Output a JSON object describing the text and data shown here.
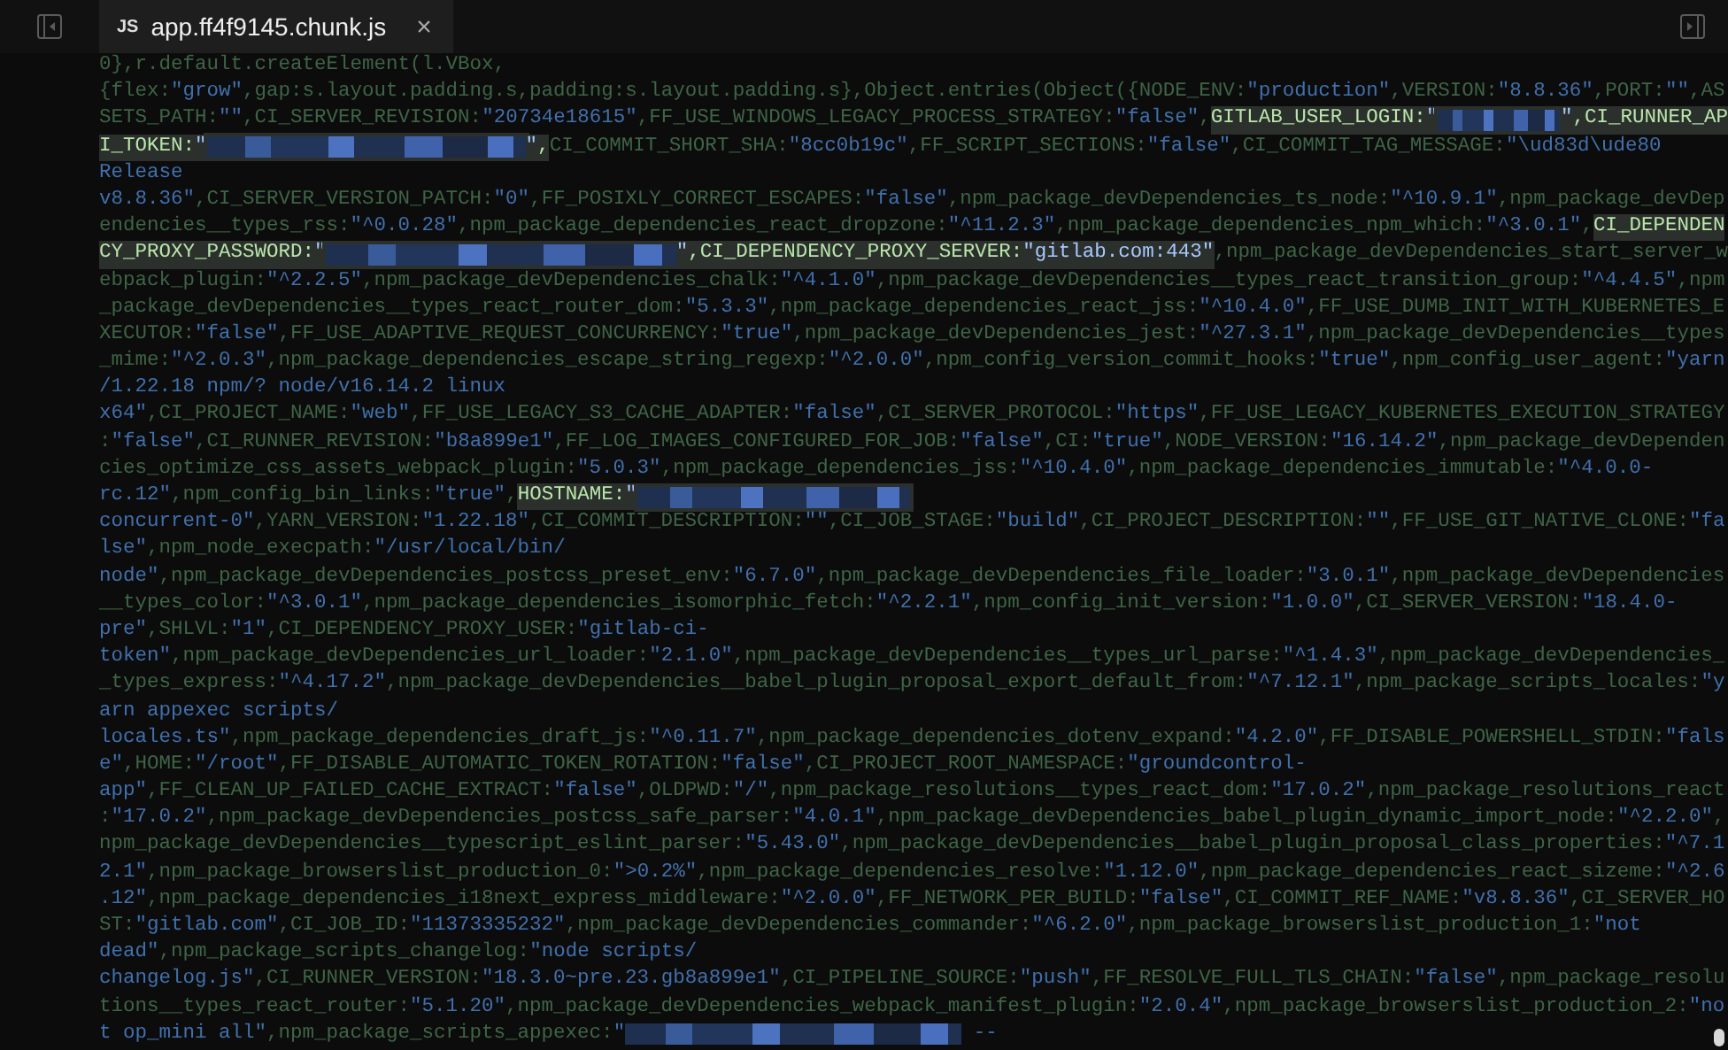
{
  "tab": {
    "badge": "JS",
    "title": "app.ff4f9145.chunk.js",
    "close": "×",
    "selected": true
  },
  "code": [
    [
      {
        "kind": "text",
        "text": "0},r.default.createElement(l.VBox,",
        "highlighted": false
      }
    ],
    [
      {
        "kind": "text",
        "text": "{flex:\"grow\",gap:s.layout.padding.s,padding:s.layout.padding.s},Object.entries(Object({NODE_ENV:\"production\",VERSION:\"8.8.36\",PORT:\"\",AS",
        "highlighted": false
      }
    ],
    [
      {
        "kind": "text",
        "text": "SETS_PATH:\"\",CI_SERVER_REVISION:\"20734e18615\",FF_USE_WINDOWS_LEGACY_PROCESS_STRATEGY:\"false\",",
        "highlighted": false
      },
      {
        "kind": "text",
        "text": "GITLAB_USER_LOGIN:\"",
        "highlighted": true
      },
      {
        "kind": "redacted",
        "highlighted": true
      },
      {
        "kind": "text",
        "text": "\",CI_RUNNER_AP",
        "highlighted": true
      }
    ],
    [
      {
        "kind": "text",
        "text": "I_TOKEN:\"",
        "highlighted": true
      },
      {
        "kind": "redacted",
        "highlighted": true
      },
      {
        "kind": "text",
        "text": "\",",
        "highlighted": true
      },
      {
        "kind": "text",
        "text": "CI_COMMIT_SHORT_SHA:\"8cc0b19c\",FF_SCRIPT_SECTIONS:\"false\",CI_COMMIT_TAG_MESSAGE:\"\\ud83d\\ude80",
        "highlighted": false
      }
    ],
    [
      {
        "kind": "text",
        "text": "Release",
        "highlighted": false
      }
    ],
    [
      {
        "kind": "text",
        "text": "v8.8.36\",CI_SERVER_VERSION_PATCH:\"0\",FF_POSIXLY_CORRECT_ESCAPES:\"false\",npm_package_devDependencies_ts_node:\"^10.9.1\",npm_package_devDep",
        "highlighted": false
      }
    ],
    [
      {
        "kind": "text",
        "text": "endencies__types_rss:\"^0.0.28\",npm_package_dependencies_react_dropzone:\"^11.2.3\",npm_package_dependencies_npm_which:\"^3.0.1\",",
        "highlighted": false
      },
      {
        "kind": "text",
        "text": "CI_DEPENDEN",
        "highlighted": true
      }
    ],
    [
      {
        "kind": "text",
        "text": "CY_PROXY_PASSWORD:\"",
        "highlighted": true
      },
      {
        "kind": "redacted",
        "highlighted": true
      },
      {
        "kind": "text",
        "text": "\",CI_DEPENDENCY_PROXY_SERVER:\"gitlab.com:443\"",
        "highlighted": true
      },
      {
        "kind": "text",
        "text": ",npm_package_devDependencies_start_server_w",
        "highlighted": false
      }
    ],
    [
      {
        "kind": "text",
        "text": "ebpack_plugin:\"^2.2.5\",npm_package_devDependencies_chalk:\"^4.1.0\",npm_package_devDependencies__types_react_transition_group:\"^4.4.5\",npm",
        "highlighted": false
      }
    ],
    [
      {
        "kind": "text",
        "text": "_package_devDependencies__types_react_router_dom:\"5.3.3\",npm_package_dependencies_react_jss:\"^10.4.0\",FF_USE_DUMB_INIT_WITH_KUBERNETES_E",
        "highlighted": false
      }
    ],
    [
      {
        "kind": "text",
        "text": "XECUTOR:\"false\",FF_USE_ADAPTIVE_REQUEST_CONCURRENCY:\"true\",npm_package_devDependencies_jest:\"^27.3.1\",npm_package_devDependencies__types",
        "highlighted": false
      }
    ],
    [
      {
        "kind": "text",
        "text": "_mime:\"^2.0.3\",npm_package_dependencies_escape_string_regexp:\"^2.0.0\",npm_config_version_commit_hooks:\"true\",npm_config_user_agent:\"yarn",
        "highlighted": false
      }
    ],
    [
      {
        "kind": "text",
        "text": "/1.22.18 npm/? node/v16.14.2 linux",
        "highlighted": false
      }
    ],
    [
      {
        "kind": "text",
        "text": "x64\",CI_PROJECT_NAME:\"web\",FF_USE_LEGACY_S3_CACHE_ADAPTER:\"false\",CI_SERVER_PROTOCOL:\"https\",FF_USE_LEGACY_KUBERNETES_EXECUTION_STRATEGY",
        "highlighted": false
      }
    ],
    [
      {
        "kind": "text",
        "text": ":\"false\",CI_RUNNER_REVISION:\"b8a899e1\",FF_LOG_IMAGES_CONFIGURED_FOR_JOB:\"false\",CI:\"true\",NODE_VERSION:\"16.14.2\",npm_package_devDependen",
        "highlighted": false
      }
    ],
    [
      {
        "kind": "text",
        "text": "cies_optimize_css_assets_webpack_plugin:\"5.0.3\",npm_package_dependencies_jss:\"^10.4.0\",npm_package_dependencies_immutable:\"^4.0.0-",
        "highlighted": false
      }
    ],
    [
      {
        "kind": "text",
        "text": "rc.12\",npm_config_bin_links:\"true\",",
        "highlighted": false
      },
      {
        "kind": "text",
        "text": "HOSTNAME:\"",
        "highlighted": true
      },
      {
        "kind": "redacted",
        "highlighted": true
      }
    ],
    [
      {
        "kind": "text",
        "text": "concurrent-0\",YARN_VERSION:\"1.22.18\",CI_COMMIT_DESCRIPTION:\"\",CI_JOB_STAGE:\"build\",CI_PROJECT_DESCRIPTION:\"\",FF_USE_GIT_NATIVE_CLONE:\"fa",
        "highlighted": false
      }
    ],
    [
      {
        "kind": "text",
        "text": "lse\",npm_node_execpath:\"/usr/local/bin/",
        "highlighted": false
      }
    ],
    [
      {
        "kind": "text",
        "text": "node\",npm_package_devDependencies_postcss_preset_env:\"6.7.0\",npm_package_devDependencies_file_loader:\"3.0.1\",npm_package_devDependencies",
        "highlighted": false
      }
    ],
    [
      {
        "kind": "text",
        "text": "__types_color:\"^3.0.1\",npm_package_dependencies_isomorphic_fetch:\"^2.2.1\",npm_config_init_version:\"1.0.0\",CI_SERVER_VERSION:\"18.4.0-",
        "highlighted": false
      }
    ],
    [
      {
        "kind": "text",
        "text": "pre\",SHLVL:\"1\",CI_DEPENDENCY_PROXY_USER:\"gitlab-ci-",
        "highlighted": false
      }
    ],
    [
      {
        "kind": "text",
        "text": "token\",npm_package_devDependencies_url_loader:\"2.1.0\",npm_package_devDependencies__types_url_parse:\"^1.4.3\",npm_package_devDependencies_",
        "highlighted": false
      }
    ],
    [
      {
        "kind": "text",
        "text": "_types_express:\"^4.17.2\",npm_package_devDependencies__babel_plugin_proposal_export_default_from:\"^7.12.1\",npm_package_scripts_locales:\"y",
        "highlighted": false
      }
    ],
    [
      {
        "kind": "text",
        "text": "arn appexec scripts/",
        "highlighted": false
      }
    ],
    [
      {
        "kind": "text",
        "text": "locales.ts\",npm_package_dependencies_draft_js:\"^0.11.7\",npm_package_dependencies_dotenv_expand:\"4.2.0\",FF_DISABLE_POWERSHELL_STDIN:\"fals",
        "highlighted": false
      }
    ],
    [
      {
        "kind": "text",
        "text": "e\",HOME:\"/root\",FF_DISABLE_AUTOMATIC_TOKEN_ROTATION:\"false\",CI_PROJECT_ROOT_NAMESPACE:\"groundcontrol-",
        "highlighted": false
      }
    ],
    [
      {
        "kind": "text",
        "text": "app\",FF_CLEAN_UP_FAILED_CACHE_EXTRACT:\"false\",OLDPWD:\"/\",npm_package_resolutions__types_react_dom:\"17.0.2\",npm_package_resolutions_react",
        "highlighted": false
      }
    ],
    [
      {
        "kind": "text",
        "text": ":\"17.0.2\",npm_package_devDependencies_postcss_safe_parser:\"4.0.1\",npm_package_devDependencies_babel_plugin_dynamic_import_node:\"^2.2.0\",",
        "highlighted": false
      }
    ],
    [
      {
        "kind": "text",
        "text": "npm_package_devDependencies__typescript_eslint_parser:\"5.43.0\",npm_package_devDependencies__babel_plugin_proposal_class_properties:\"^7.1",
        "highlighted": false
      }
    ],
    [
      {
        "kind": "text",
        "text": "2.1\",npm_package_browserslist_production_0:\">0.2%\",npm_package_dependencies_resolve:\"1.12.0\",npm_package_dependencies_react_sizeme:\"^2.6",
        "highlighted": false
      }
    ],
    [
      {
        "kind": "text",
        "text": ".12\",npm_package_dependencies_i18next_express_middleware:\"^2.0.0\",FF_NETWORK_PER_BUILD:\"false\",CI_COMMIT_REF_NAME:\"v8.8.36\",CI_SERVER_HO",
        "highlighted": false
      }
    ],
    [
      {
        "kind": "text",
        "text": "ST:\"gitlab.com\",CI_JOB_ID:\"11373335232\",npm_package_devDependencies_commander:\"^6.2.0\",npm_package_browserslist_production_1:\"not",
        "highlighted": false
      }
    ],
    [
      {
        "kind": "text",
        "text": "dead\",npm_package_scripts_changelog:\"node scripts/",
        "highlighted": false
      }
    ],
    [
      {
        "kind": "text",
        "text": "changelog.js\",CI_RUNNER_VERSION:\"18.3.0~pre.23.gb8a899e1\",CI_PIPELINE_SOURCE:\"push\",FF_RESOLVE_FULL_TLS_CHAIN:\"false\",npm_package_resolu",
        "highlighted": false
      }
    ],
    [
      {
        "kind": "text",
        "text": "tions__types_react_router:\"5.1.20\",npm_package_devDependencies_webpack_manifest_plugin:\"2.0.4\",npm_package_browserslist_production_2:\"no",
        "highlighted": false
      }
    ],
    [
      {
        "kind": "text",
        "text": "t op_mini all\",npm_package_scripts_appexec:\"",
        "highlighted": false
      },
      {
        "kind": "redacted",
        "highlighted": false
      },
      {
        "kind": "text",
        "text": " --",
        "highlighted": false
      }
    ]
  ]
}
